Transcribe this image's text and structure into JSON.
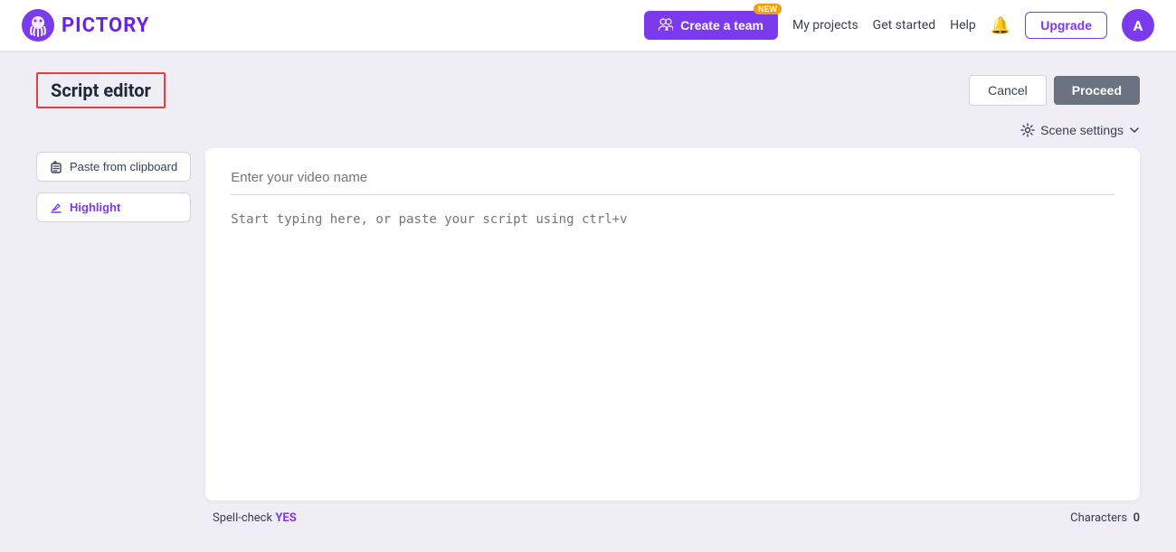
{
  "header": {
    "logo_text": "PICTORY",
    "create_team_label": "Create a team",
    "new_badge": "NEW",
    "nav_items": [
      "My projects",
      "Get started",
      "Help"
    ],
    "upgrade_label": "Upgrade",
    "avatar_letter": "A"
  },
  "page": {
    "title": "Script editor",
    "cancel_label": "Cancel",
    "proceed_label": "Proceed",
    "scene_settings_label": "Scene settings"
  },
  "sidebar": {
    "paste_label": "Paste from clipboard",
    "highlight_label": "Highlight"
  },
  "editor": {
    "video_name_placeholder": "Enter your video name",
    "script_placeholder": "Start typing here, or paste your script using ctrl+v"
  },
  "footer": {
    "spell_check_label": "Spell-check",
    "spell_check_value": "YES",
    "characters_label": "Characters",
    "characters_count": "0"
  }
}
